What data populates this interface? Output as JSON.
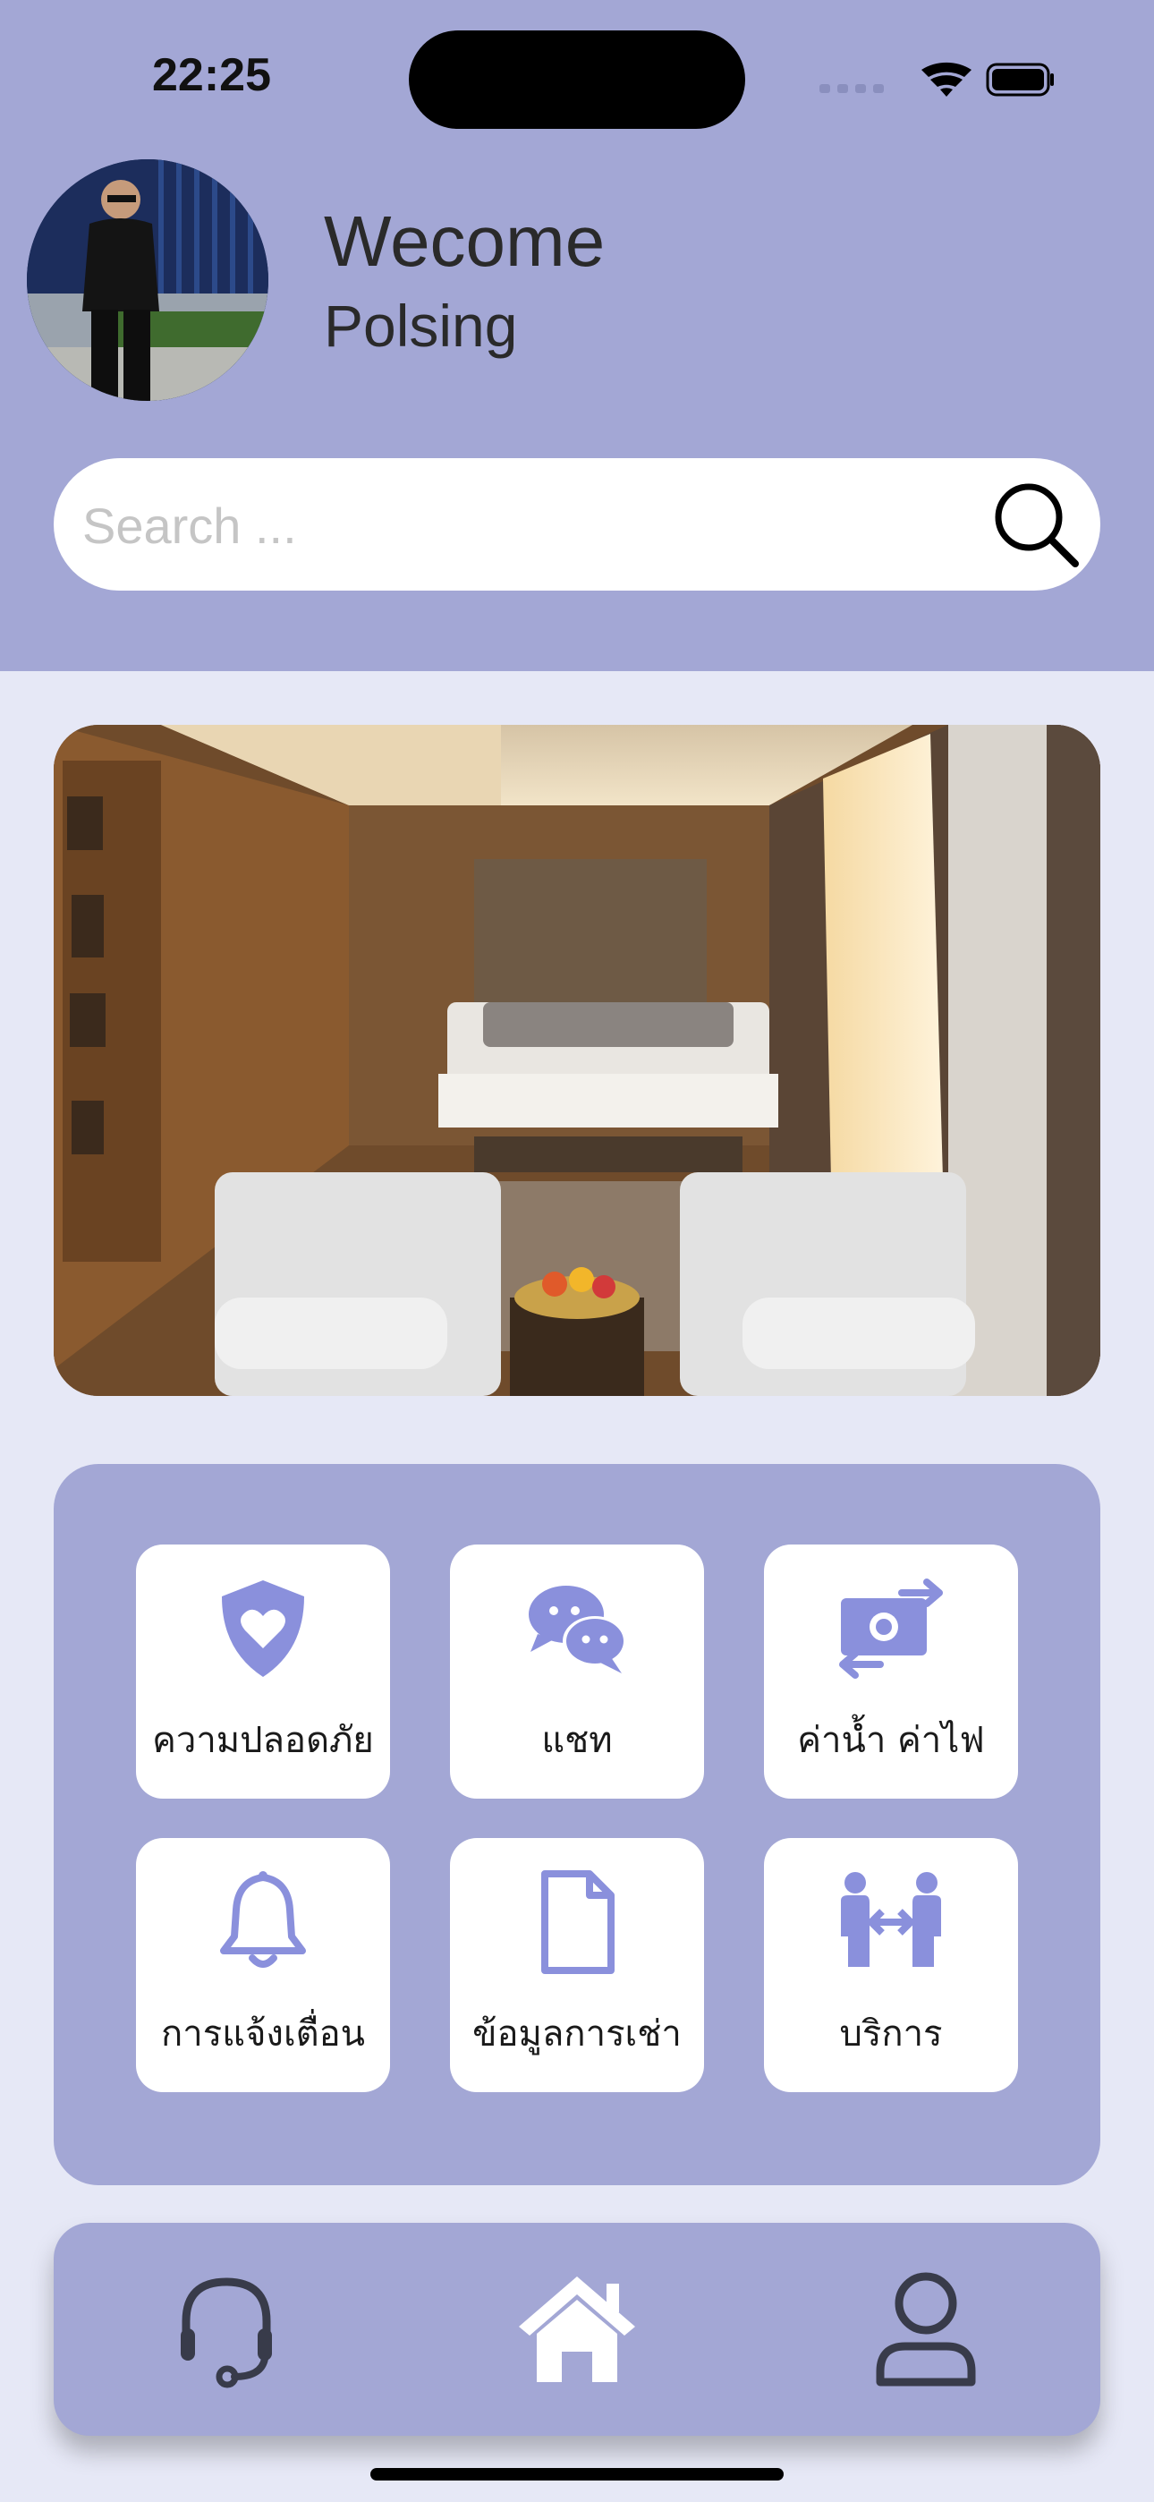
{
  "status_bar": {
    "time": "22:25"
  },
  "header": {
    "greeting": "Wecome",
    "username": "Polsing"
  },
  "search": {
    "placeholder": "Search ..."
  },
  "menu": {
    "items": [
      {
        "label": "ความปลอดภัย",
        "icon": "shield-heart-icon"
      },
      {
        "label": "แชท",
        "icon": "chat-bubbles-icon"
      },
      {
        "label": "ค่าน้ำ ค่าไฟ",
        "icon": "money-exchange-icon"
      },
      {
        "label": "การแจ้งเตื่อน",
        "icon": "bell-icon"
      },
      {
        "label": "ข้อมูลการเช่า",
        "icon": "document-icon"
      },
      {
        "label": "บริการ",
        "icon": "people-exchange-icon"
      }
    ]
  },
  "bottom_nav": {
    "items": [
      {
        "icon": "headset-icon"
      },
      {
        "icon": "home-icon"
      },
      {
        "icon": "user-icon"
      }
    ]
  },
  "colors": {
    "header_bg": "#a3a7d5",
    "page_bg": "#e6e8f6",
    "icon_accent": "#8a90dc"
  }
}
